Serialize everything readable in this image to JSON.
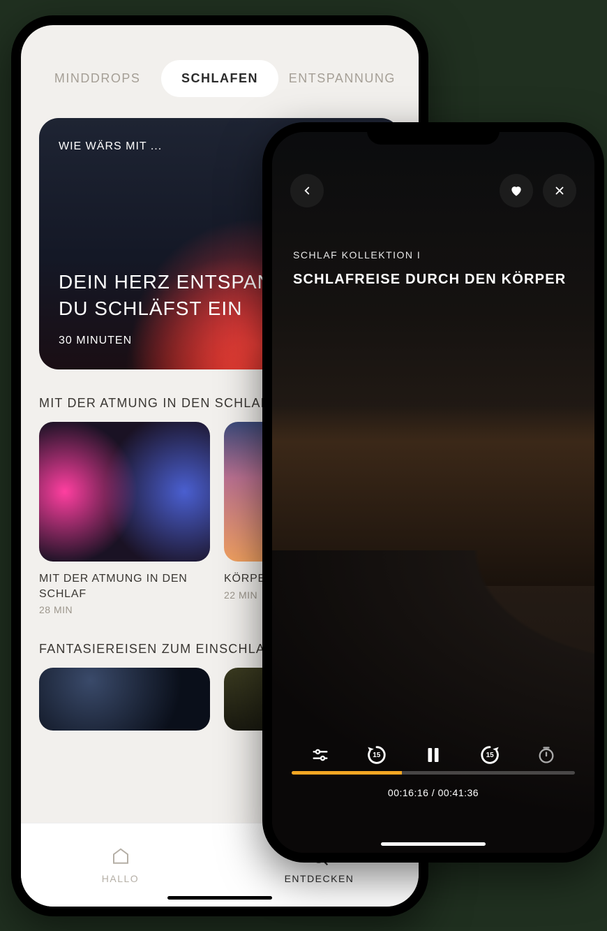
{
  "left": {
    "tabs": [
      {
        "label": "MINDDROPS",
        "active": false
      },
      {
        "label": "SCHLAFEN",
        "active": true
      },
      {
        "label": "ENTSPANNUNG",
        "active": false
      }
    ],
    "hero": {
      "eyebrow": "WIE WÄRS MIT ...",
      "title": "DEIN HERZ ENTSPANNT SICH – DU SCHLÄFST EIN",
      "duration": "30 MINUTEN"
    },
    "section1": {
      "title": "MIT DER ATMUNG IN DEN SCHLAF",
      "items": [
        {
          "title": "MIT DER ATMUNG IN DEN SCHLAF",
          "dur": "28 MIN"
        },
        {
          "title": "KÖRPER ATEMÜBUNG",
          "dur": "22 MIN"
        }
      ]
    },
    "section2": {
      "title": "FANTASIEREISEN ZUM EINSCHLAFEN"
    },
    "nav": [
      {
        "label": "HALLO",
        "active": false
      },
      {
        "label": "ENTDECKEN",
        "active": true
      }
    ]
  },
  "player": {
    "collection": "SCHLAF KOLLEKTION I",
    "title": "SCHLAFREISE DURCH DEN KÖRPER",
    "skip_seconds": "15",
    "current": "00:16:16",
    "total": "00:41:36",
    "time_separator": " / ",
    "progress_pct": 39
  }
}
